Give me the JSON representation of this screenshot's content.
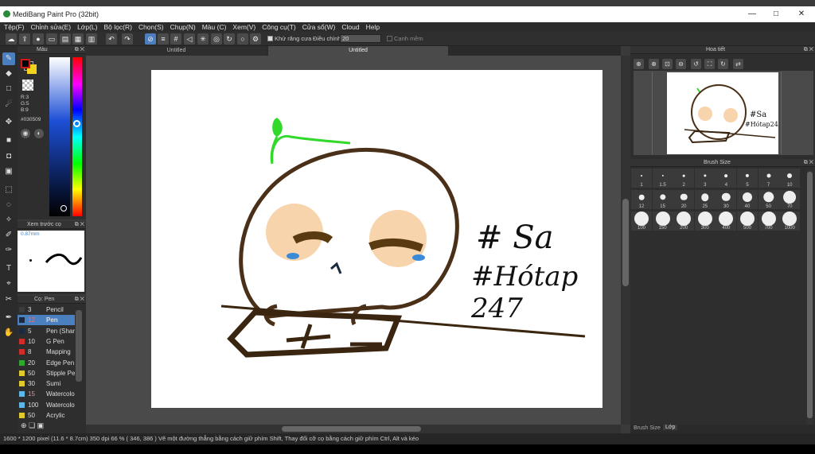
{
  "window": {
    "title": "MediBang Paint Pro (32bit)",
    "minimize": "—",
    "maximize": "□",
    "close": "✕"
  },
  "menu": [
    "Tệp(F)",
    "Chỉnh sửa(E)",
    "Lớp(L)",
    "Bộ lọc(R)",
    "Chọn(S)",
    "Chụp(N)",
    "Màu (C)",
    "Xem(V)",
    "Công cụ(T)",
    "Cửa sổ(W)",
    "Cloud",
    "Help"
  ],
  "toolbar": {
    "antialias_label": "Khử răng cưa",
    "adjust_label": "Điều chỉnh",
    "adjust_value": "20",
    "soft_edge_label": "Cạnh mềm"
  },
  "tabs": [
    "Untitled",
    "Untitled"
  ],
  "color_panel": {
    "title": "Màu",
    "r": "R:3",
    "g": "G:5",
    "b": "B:9",
    "hex": "#030509",
    "fg_color": "#030509",
    "bg_color": "#f2d21b"
  },
  "preview_panel": {
    "title": "Xem trước cọ",
    "size": "0.87mm"
  },
  "brush_panel": {
    "title": "Cọ: Pen",
    "items": [
      {
        "size": "3",
        "name": "Pencil",
        "color": "#3b3b3b"
      },
      {
        "size": "12",
        "name": "Pen",
        "color": "#1a2a40",
        "selected": true
      },
      {
        "size": "5",
        "name": "Pen (Shar",
        "color": "#1a2a40"
      },
      {
        "size": "10",
        "name": "G Pen",
        "color": "#d42b2b"
      },
      {
        "size": "8",
        "name": "Mapping",
        "color": "#d42b2b"
      },
      {
        "size": "20",
        "name": "Edge Pen",
        "color": "#2ea82e"
      },
      {
        "size": "50",
        "name": "Stipple Pe",
        "color": "#e0c92a"
      },
      {
        "size": "30",
        "name": "Sumi",
        "color": "#e0c92a"
      },
      {
        "size": "15",
        "name": "Watercolo",
        "color": "#5fb7e8"
      },
      {
        "size": "100",
        "name": "Watercolo",
        "color": "#5fb7e8"
      },
      {
        "size": "50",
        "name": "Acrylic",
        "color": "#e0c92a"
      }
    ]
  },
  "navigator": {
    "title": "Hoa tiết"
  },
  "brush_size": {
    "title": "Brush Size",
    "sizes": [
      "1",
      "1.5",
      "2",
      "3",
      "4",
      "5",
      "7",
      "10",
      "12",
      "15",
      "20",
      "25",
      "30",
      "40",
      "50",
      "70",
      "100",
      "150",
      "200",
      "300",
      "400",
      "500",
      "700",
      "1000"
    ]
  },
  "right_tabs": [
    "Brush Size",
    "Lớp"
  ],
  "status": "1600 * 1200 pixel   (11.6 * 8.7cm)   350 dpi   66 %   ( 346, 386 )   Vẽ một đường thẳng bằng cách giữ phím Shift, Thay đổi cỡ cọ bằng cách giữ phím Ctrl, Alt và kéo",
  "canvas_text": {
    "line1": "# Sa",
    "line2": "#Hótap 247"
  }
}
